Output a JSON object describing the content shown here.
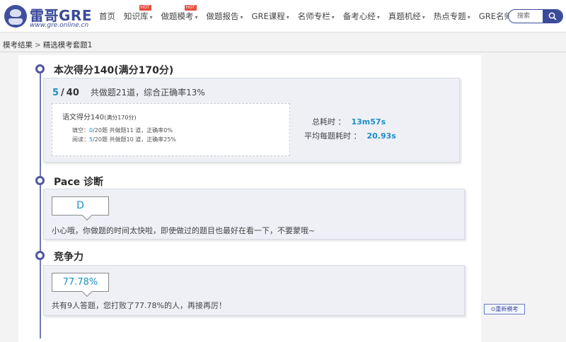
{
  "header": {
    "logo_name": "雷哥GRE",
    "logo_url": "www.gre.online.cn",
    "nav": [
      {
        "label": "首页",
        "caret": false,
        "hot": false
      },
      {
        "label": "知识库",
        "caret": true,
        "hot": true
      },
      {
        "label": "做题模考",
        "caret": true,
        "hot": true
      },
      {
        "label": "做题报告",
        "caret": true,
        "hot": false
      },
      {
        "label": "GRE课程",
        "caret": true,
        "hot": false
      },
      {
        "label": "名师专栏",
        "caret": true,
        "hot": false
      },
      {
        "label": "备考心经",
        "caret": true,
        "hot": false
      },
      {
        "label": "真题机经",
        "caret": true,
        "hot": false
      },
      {
        "label": "热点专题",
        "caret": true,
        "hot": false
      },
      {
        "label": "GRE名师",
        "caret": false,
        "hot": false
      }
    ],
    "hot_label": "HOT",
    "caret_glyph": "▾",
    "search_placeholder": "搜索"
  },
  "breadcrumb": {
    "root": "模考结果",
    "separator": ">",
    "current": "精选模考套题1"
  },
  "score_section": {
    "title": "本次得分140(满分170分)",
    "correct": "5",
    "total": "40",
    "summary": "共做题21道，综合正确率13%",
    "verbal_title": "语文得分140",
    "verbal_title_small": "(满分170分)",
    "fill_prefix": "填空：",
    "fill_correct": "0",
    "fill_suffix": "/20题 共做题11 道，正确率0%",
    "read_prefix": "阅读：",
    "read_correct": "5",
    "read_suffix": "/20题 共做题10 道，正确率25%",
    "total_time_label": "总耗时 ：",
    "total_time": "13m57s",
    "avg_time_label": "平均每题耗时 ：",
    "avg_time": "20.93s"
  },
  "pace_section": {
    "title": "Pace 诊断",
    "grade": "D",
    "message": "小心哦，你做题的时间太快啦，即使做过的题目也最好在看一下，不要蒙哦~"
  },
  "compete_section": {
    "title": "竞争力",
    "percent": "77.78%",
    "message": "共有9人答题，您打败了77.78%的人，再接再厉！"
  },
  "retake_label": "⊙重新模考",
  "colors": {
    "brand": "#3b4b9a",
    "accent": "#1b8fc6",
    "hot": "#e74c3c"
  }
}
